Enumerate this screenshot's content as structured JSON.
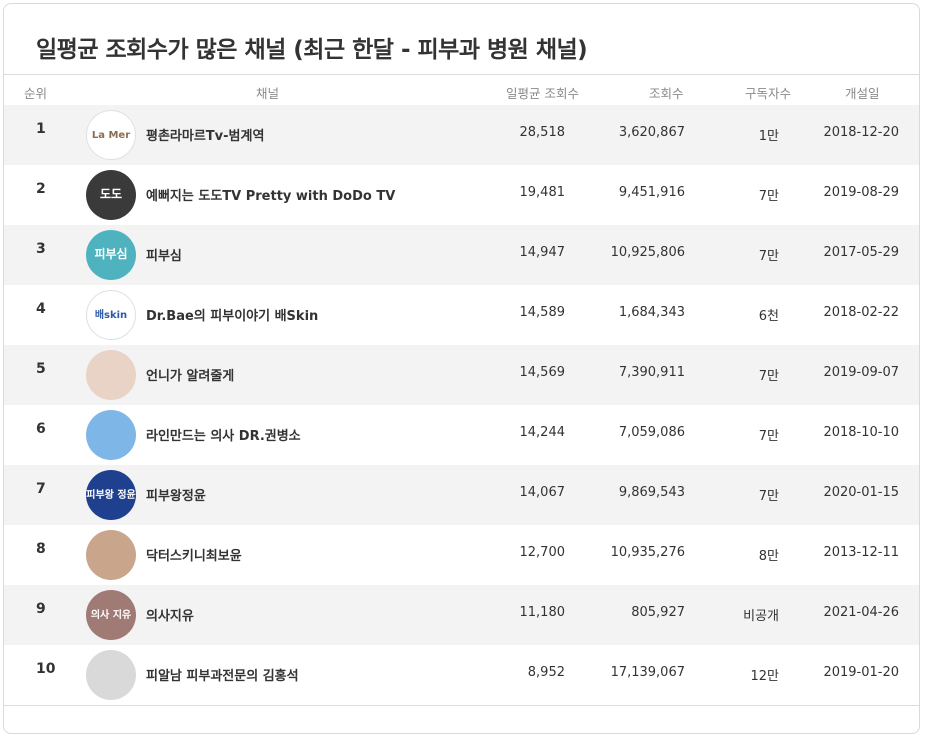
{
  "title": "일평균 조회수가 많은 채널 (최근 한달 - 피부과 병원 채널)",
  "columns": {
    "rank": "순위",
    "channel": "채널",
    "avg_views": "일평균 조회수",
    "views": "조회수",
    "subscribers": "구독자수",
    "opened": "개설일"
  },
  "rows": [
    {
      "rank": "1",
      "name": "평촌라마르Tv-범계역",
      "avg": "28,518",
      "views": "3,620,867",
      "subs": "1만",
      "date": "2018-12-20",
      "avatar_text": "La Mer",
      "avatar_bg": "#ffffff",
      "avatar_fg": "#8a6d4e"
    },
    {
      "rank": "2",
      "name": "예뻐지는 도도TV Pretty with DoDo TV",
      "avg": "19,481",
      "views": "9,451,916",
      "subs": "7만",
      "date": "2019-08-29",
      "avatar_text": "도도",
      "avatar_bg": "#3a3a3a",
      "avatar_fg": "#ffffff"
    },
    {
      "rank": "3",
      "name": "피부심",
      "avg": "14,947",
      "views": "10,925,806",
      "subs": "7만",
      "date": "2017-05-29",
      "avatar_text": "피부심",
      "avatar_bg": "#4fb3bf",
      "avatar_fg": "#ffffff"
    },
    {
      "rank": "4",
      "name": "Dr.Bae의 피부이야기 배Skin",
      "avg": "14,589",
      "views": "1,684,343",
      "subs": "6천",
      "date": "2018-02-22",
      "avatar_text": "배skin",
      "avatar_bg": "#ffffff",
      "avatar_fg": "#2d5aa8"
    },
    {
      "rank": "5",
      "name": "언니가 알려줄게",
      "avg": "14,569",
      "views": "7,390,911",
      "subs": "7만",
      "date": "2019-09-07",
      "avatar_text": "",
      "avatar_bg": "#e8d3c6",
      "avatar_fg": "#6b4a3a"
    },
    {
      "rank": "6",
      "name": "라인만드는 의사 DR.권병소",
      "avg": "14,244",
      "views": "7,059,086",
      "subs": "7만",
      "date": "2018-10-10",
      "avatar_text": "",
      "avatar_bg": "#7fb6e8",
      "avatar_fg": "#ffffff"
    },
    {
      "rank": "7",
      "name": "피부왕정윤",
      "avg": "14,067",
      "views": "9,869,543",
      "subs": "7만",
      "date": "2020-01-15",
      "avatar_text": "피부왕 정윤",
      "avatar_bg": "#1f3f8f",
      "avatar_fg": "#ffffff"
    },
    {
      "rank": "8",
      "name": "닥터스키니최보윤",
      "avg": "12,700",
      "views": "10,935,276",
      "subs": "8만",
      "date": "2013-12-11",
      "avatar_text": "",
      "avatar_bg": "#c9a58c",
      "avatar_fg": "#ffffff"
    },
    {
      "rank": "9",
      "name": "의사지유",
      "avg": "11,180",
      "views": "805,927",
      "subs": "비공개",
      "date": "2021-04-26",
      "avatar_text": "의사 지유",
      "avatar_bg": "#a07a74",
      "avatar_fg": "#ffffff"
    },
    {
      "rank": "10",
      "name": "피알남 피부과전문의 김홍석",
      "avg": "8,952",
      "views": "17,139,067",
      "subs": "12만",
      "date": "2019-01-20",
      "avatar_text": "",
      "avatar_bg": "#d9d9d9",
      "avatar_fg": "#555555"
    }
  ]
}
